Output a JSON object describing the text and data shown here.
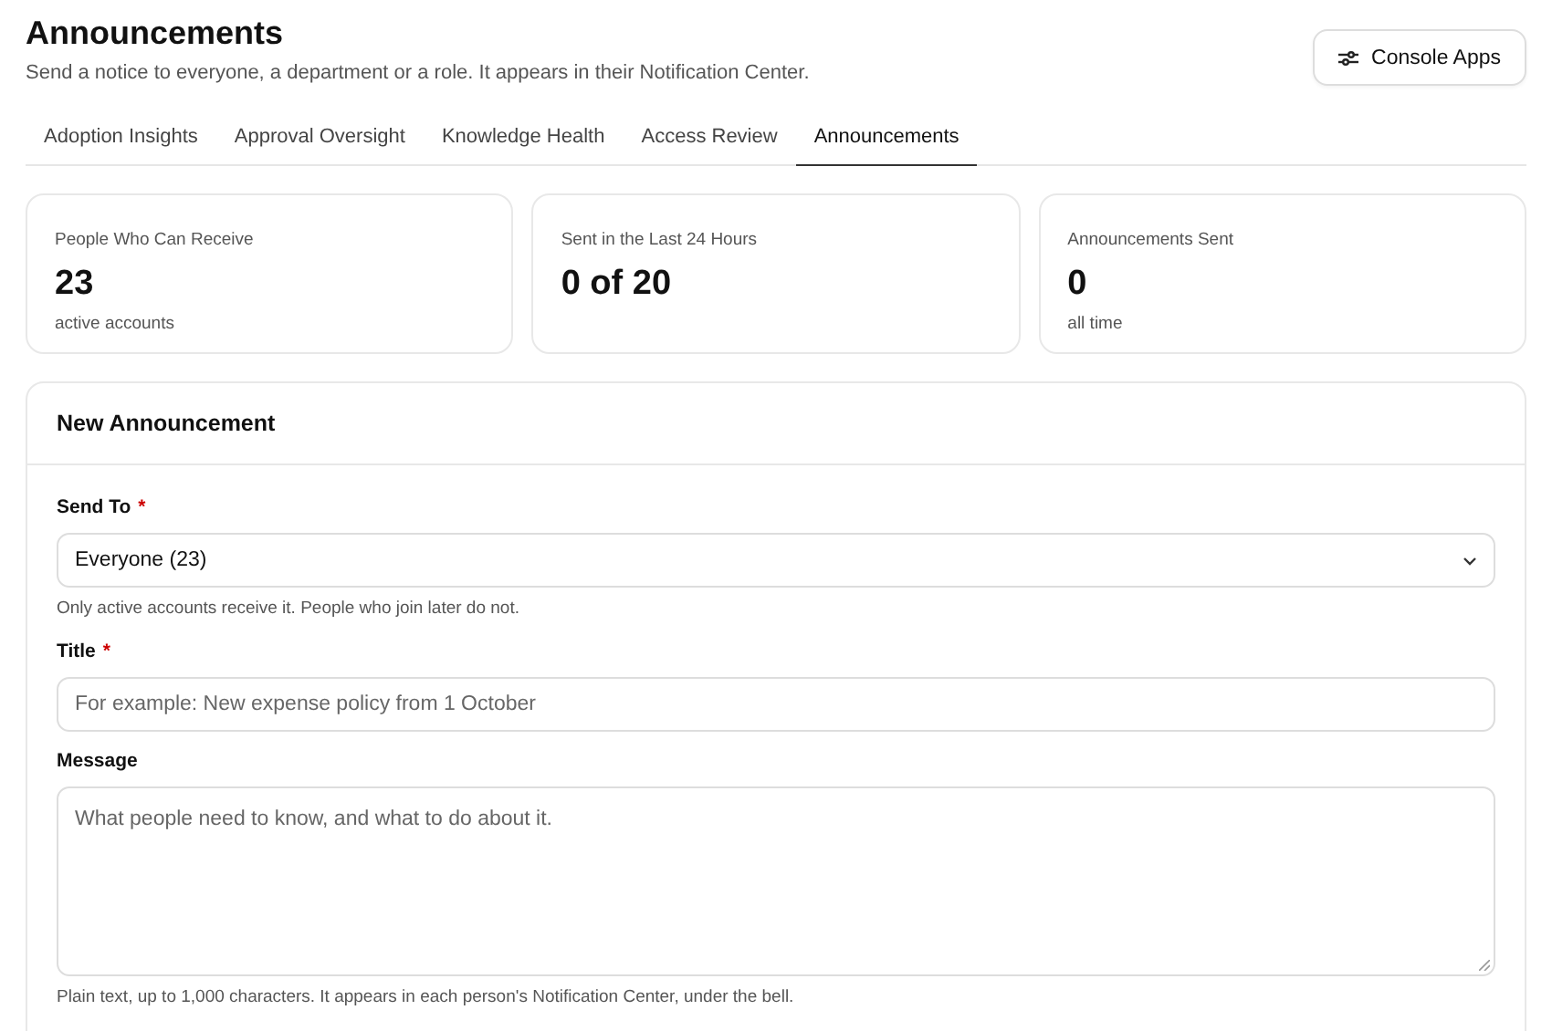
{
  "header": {
    "title": "Announcements",
    "subtitle": "Send a notice to everyone, a department or a role. It appears in their Notification Center.",
    "button": "Console Apps"
  },
  "tabs": [
    {
      "label": "Adoption Insights",
      "selected": false
    },
    {
      "label": "Approval Oversight",
      "selected": false
    },
    {
      "label": "Knowledge Health",
      "selected": false
    },
    {
      "label": "Access Review",
      "selected": false
    },
    {
      "label": "Announcements",
      "selected": true
    }
  ],
  "stats": [
    {
      "label": "People Who Can Receive",
      "value": "23",
      "note": "active accounts"
    },
    {
      "label": "Sent in the Last 24 Hours",
      "value": "0 of 20"
    },
    {
      "label": "Announcements Sent",
      "value": "0",
      "note": "all time"
    }
  ],
  "form": {
    "title": "New Announcement",
    "fields": [
      {
        "kind": "select",
        "label": "Send To",
        "required_mark": "*",
        "value": "Everyone (23)",
        "help": "Only active accounts receive it. People who join later do not."
      },
      {
        "kind": "text",
        "label": "Title",
        "required_mark": "*",
        "placeholder": "For example: New expense policy from 1 October"
      },
      {
        "kind": "textarea",
        "label": "Message",
        "placeholder": "What people need to know, and what to do about it.",
        "help": "Plain text, up to 1,000 characters. It appears in each person's Notification Center, under the bell."
      }
    ]
  }
}
